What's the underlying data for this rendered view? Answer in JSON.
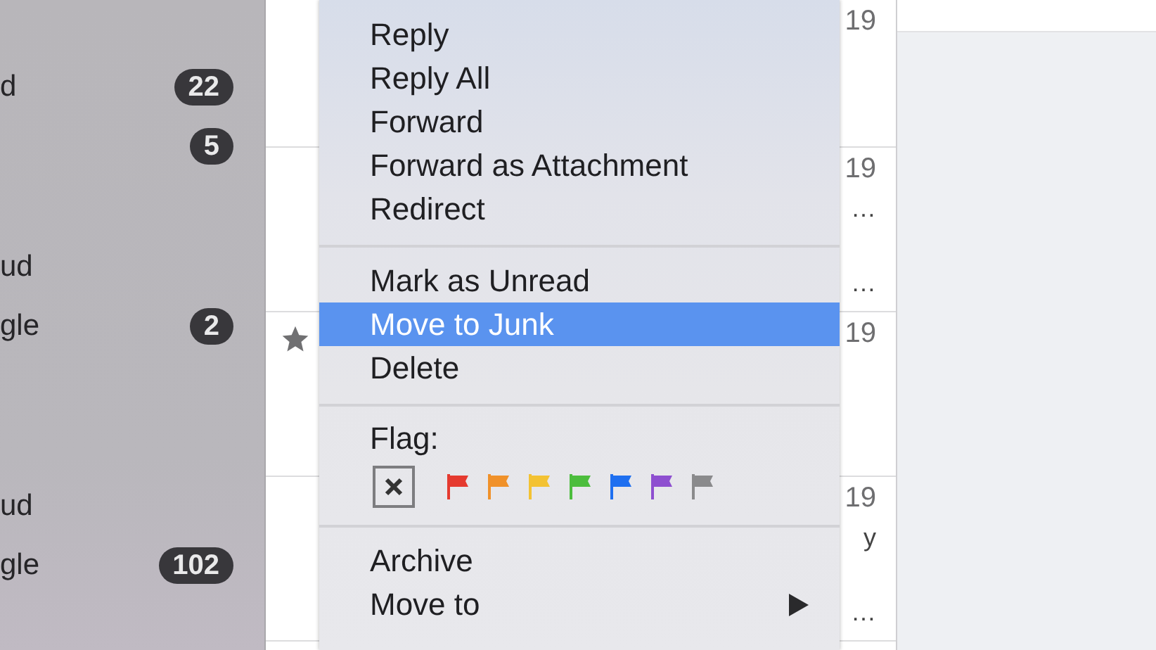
{
  "sidebar": {
    "groups": [
      {
        "rows": [
          {
            "label": "d",
            "badge": "22"
          },
          {
            "badge": "5"
          }
        ]
      },
      {
        "rows": [
          {
            "label": "ud"
          },
          {
            "label": "gle",
            "badge": "2"
          }
        ]
      },
      {
        "rows": [
          {
            "label": "ud"
          },
          {
            "label": "gle",
            "badge": "102"
          }
        ]
      }
    ]
  },
  "message_list": {
    "rows": [
      {
        "date": "19",
        "starred": false
      },
      {
        "date": "19",
        "starred": false,
        "lines": [
          "…",
          "…"
        ]
      },
      {
        "date": "19",
        "starred": true
      },
      {
        "date": "19",
        "starred": false,
        "lines": [
          "y",
          "…"
        ]
      }
    ]
  },
  "context_menu": {
    "sections": [
      {
        "kind": "items",
        "items": [
          {
            "label": "Reply",
            "selected": false
          },
          {
            "label": "Reply All",
            "selected": false
          },
          {
            "label": "Forward",
            "selected": false
          },
          {
            "label": "Forward as Attachment",
            "selected": false
          },
          {
            "label": "Redirect",
            "selected": false
          }
        ]
      },
      {
        "kind": "items",
        "items": [
          {
            "label": "Mark as Unread",
            "selected": false
          },
          {
            "label": "Move to Junk",
            "selected": true
          },
          {
            "label": "Delete",
            "selected": false
          }
        ]
      },
      {
        "kind": "flags",
        "label": "Flag:",
        "flags": [
          {
            "color": "#e53a2f"
          },
          {
            "color": "#f0912a"
          },
          {
            "color": "#f3c233"
          },
          {
            "color": "#4cbd3d"
          },
          {
            "color": "#1e6ff0"
          },
          {
            "color": "#8e4fd0"
          },
          {
            "color": "#8a8a8c"
          }
        ]
      },
      {
        "kind": "items",
        "items": [
          {
            "label": "Archive",
            "selected": false
          },
          {
            "label": "Move to",
            "selected": false,
            "submenu": true
          }
        ]
      }
    ]
  }
}
